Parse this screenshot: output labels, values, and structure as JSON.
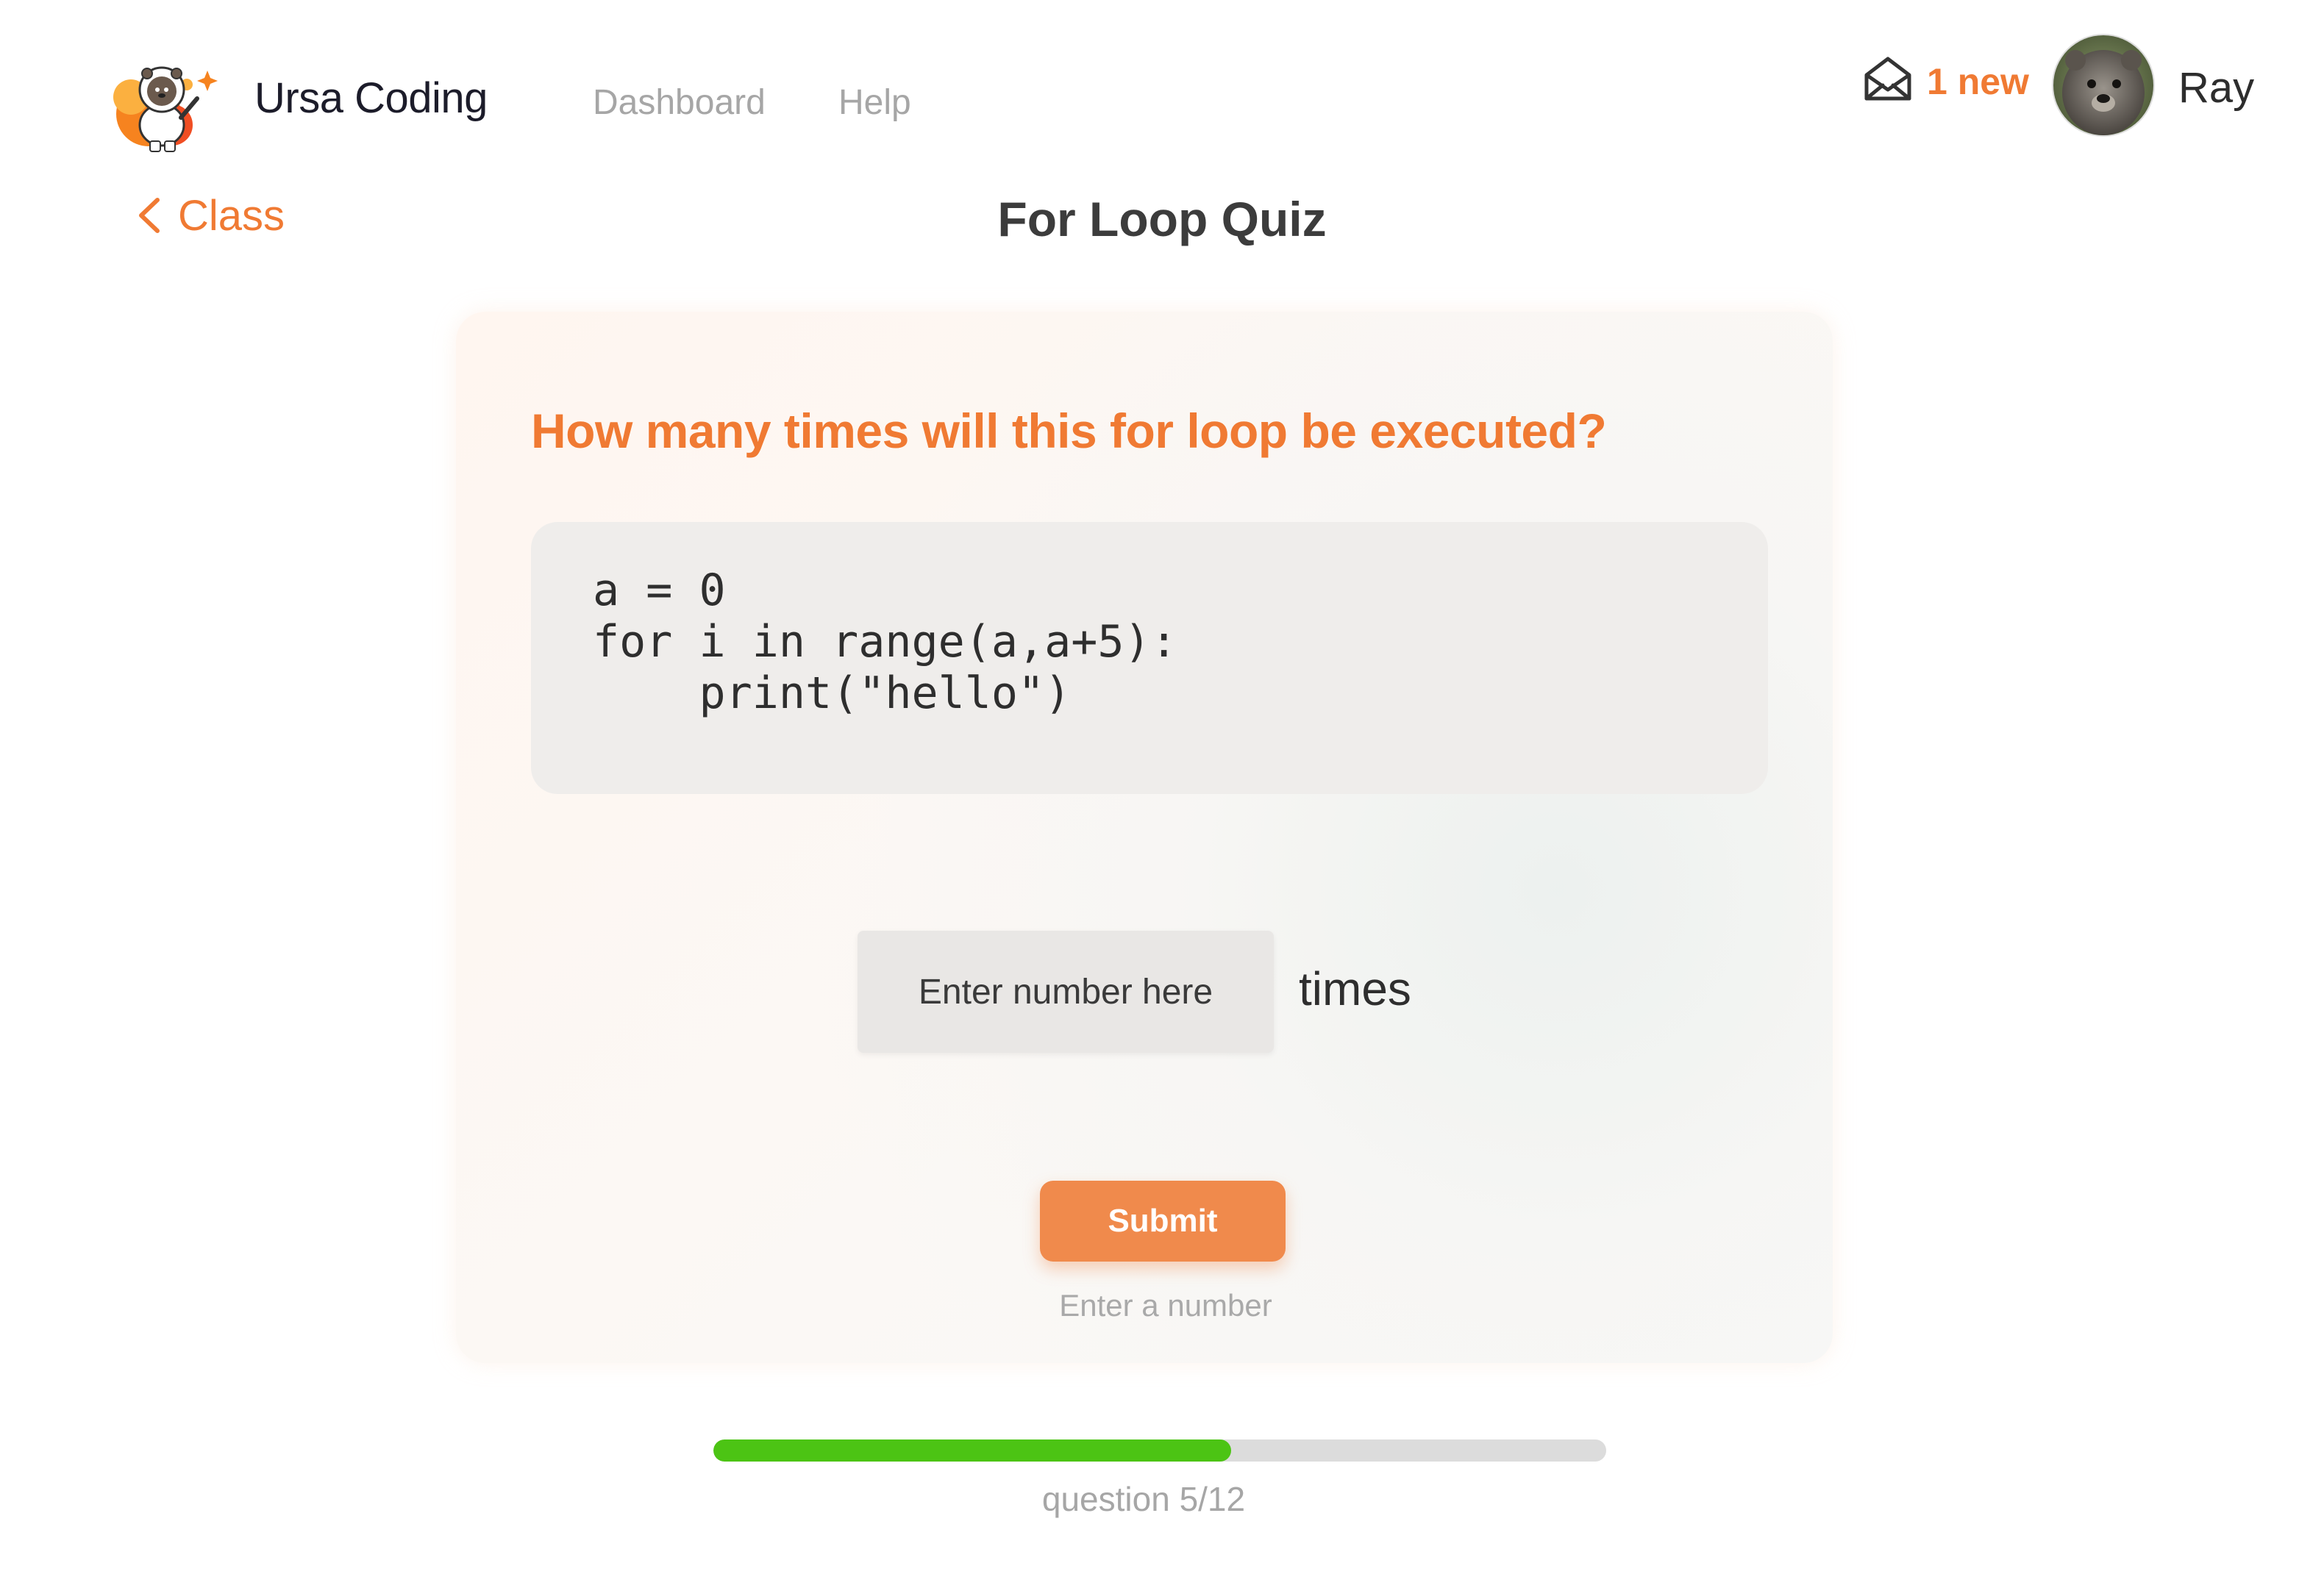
{
  "header": {
    "brand": "Ursa Coding",
    "logo_icon": "astronaut-bear-logo",
    "nav": [
      {
        "label": "Dashboard"
      },
      {
        "label": "Help"
      }
    ],
    "notifications": {
      "icon": "mail-icon",
      "label": "1 new"
    },
    "user": {
      "name": "Ray",
      "avatar_icon": "bear-avatar"
    }
  },
  "subheader": {
    "back_label": "Class",
    "title": "For Loop Quiz"
  },
  "quiz": {
    "question": "How many times will this for loop be executed?",
    "code_lines": [
      "a = 0",
      "for i in range(a,a+5):",
      "    print(\"hello\")"
    ],
    "answer": {
      "value": "",
      "placeholder": "Enter number here",
      "unit": "times"
    },
    "submit_label": "Submit",
    "hint": "Enter a number"
  },
  "progress": {
    "current": 5,
    "total": 12,
    "fraction": 0.58,
    "label": "question 5/12"
  },
  "colors": {
    "accent": "#f07a33",
    "button": "#f08a4c",
    "progress_fill": "#4cc414",
    "progress_track": "#dcdcdc",
    "code_bg": "#efedeb"
  }
}
